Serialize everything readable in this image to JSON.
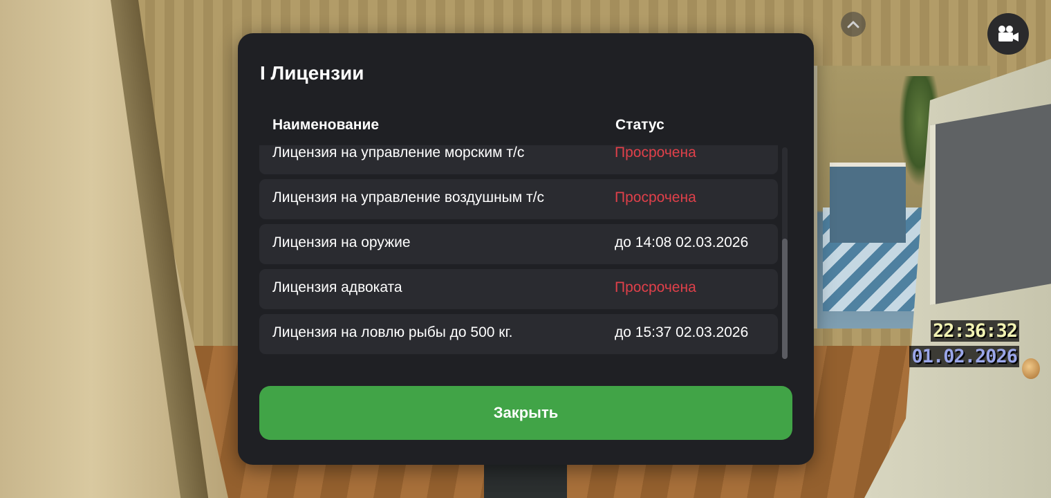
{
  "dialog": {
    "title": "I Лицензии",
    "columns": {
      "name": "Наименование",
      "status": "Статус"
    },
    "licenses": [
      {
        "name": "Лицензия на управление морским т/с",
        "status": "Просрочена",
        "expired": true
      },
      {
        "name": "Лицензия на управление воздушным т/с",
        "status": "Просрочена",
        "expired": true
      },
      {
        "name": "Лицензия на оружие",
        "status": "до 14:08 02.03.2026",
        "expired": false
      },
      {
        "name": "Лицензия адвоката",
        "status": "Просрочена",
        "expired": true
      },
      {
        "name": "Лицензия на ловлю рыбы до 500 кг.",
        "status": "до 15:37 02.03.2026",
        "expired": false
      }
    ],
    "close_label": "Закрыть"
  },
  "hud": {
    "time": "22:36:32",
    "date": "01.02.2026",
    "camera_icon": "video-camera-icon",
    "chevron_icon": "chevron-up-icon"
  },
  "colors": {
    "dialog_bg": "#1f2024",
    "row_bg": "#2a2b30",
    "expired": "#e0404a",
    "close_button": "#41a447"
  }
}
